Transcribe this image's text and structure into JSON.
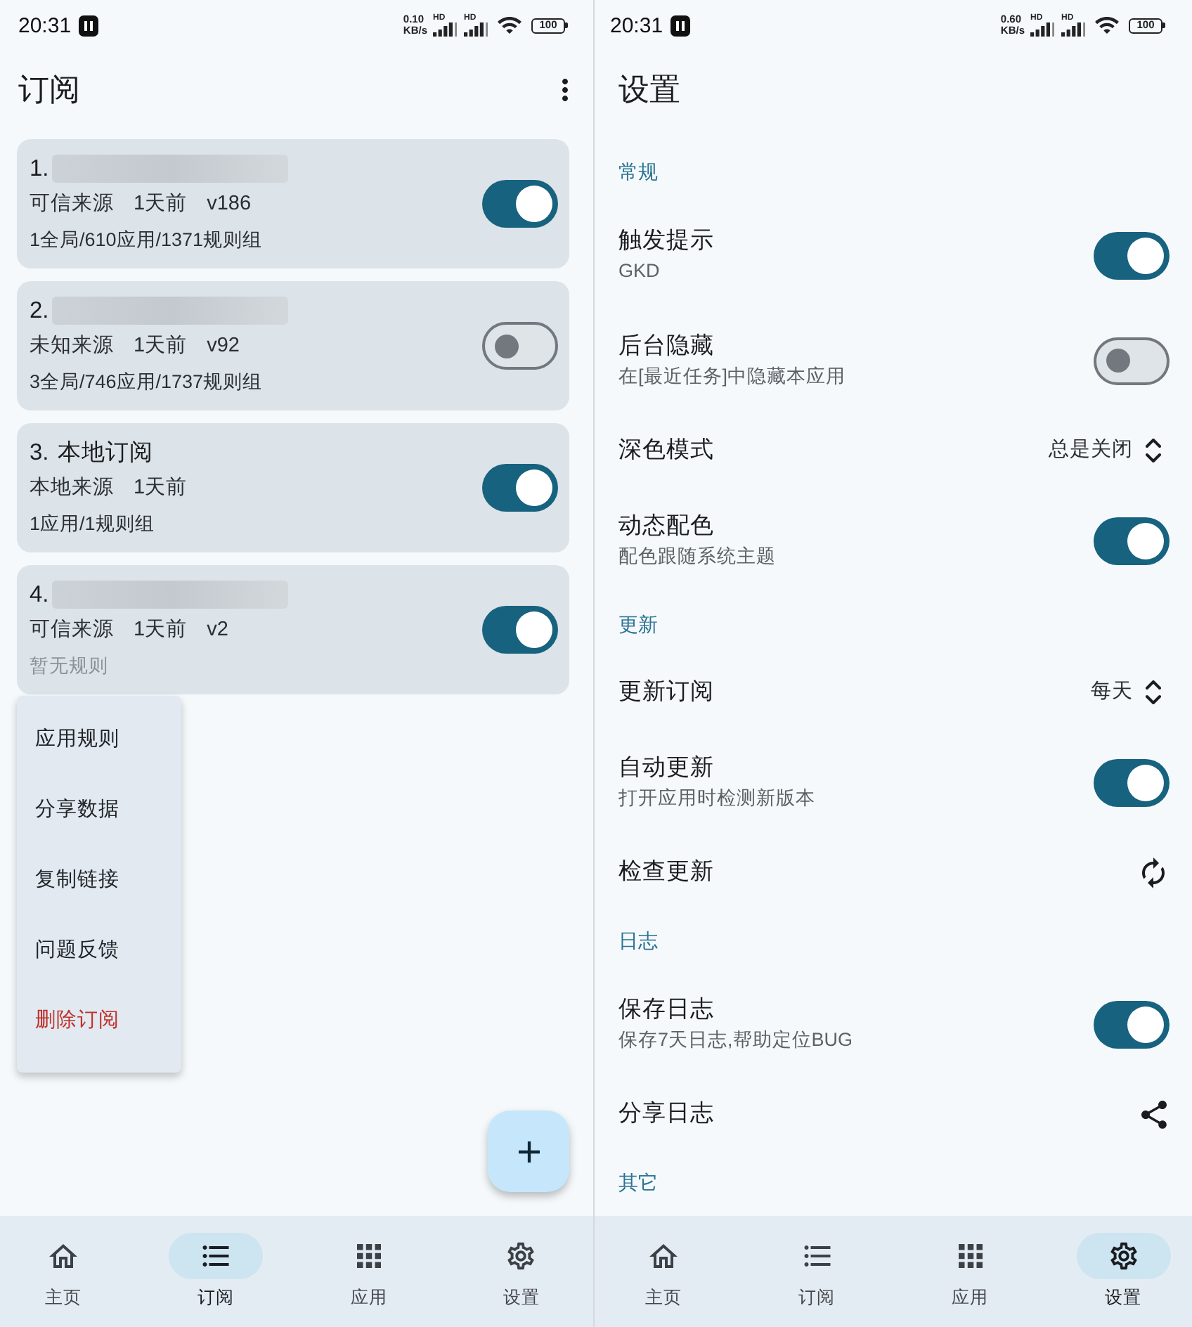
{
  "subscriptions_page": {
    "status_bar": {
      "time": "20:31",
      "net_speed": "0.10",
      "net_unit": "KB/s",
      "networks": [
        "HD",
        "HD"
      ],
      "battery": "100"
    },
    "title": "订阅",
    "cards": [
      {
        "number": "1.",
        "name_hidden": true,
        "source": "可信来源",
        "updated": "1天前",
        "version": "v186",
        "stats": "1全局/610应用/1371规则组",
        "stats_empty": false,
        "enabled": true
      },
      {
        "number": "2.",
        "name_hidden": true,
        "source": "未知来源",
        "updated": "1天前",
        "version": "v92",
        "stats": "3全局/746应用/1737规则组",
        "stats_empty": false,
        "enabled": false
      },
      {
        "number": "3.",
        "name_hidden": false,
        "name": "本地订阅",
        "source": "本地来源",
        "updated": "1天前",
        "stats": "1应用/1规则组",
        "stats_empty": false,
        "enabled": true
      },
      {
        "number": "4.",
        "name_hidden": true,
        "source": "可信来源",
        "updated": "1天前",
        "version": "v2",
        "stats": "暂无规则",
        "stats_empty": true,
        "enabled": true
      }
    ],
    "context_menu": [
      {
        "label": "应用规则",
        "danger": false
      },
      {
        "label": "分享数据",
        "danger": false
      },
      {
        "label": "复制链接",
        "danger": false
      },
      {
        "label": "问题反馈",
        "danger": false
      },
      {
        "label": "删除订阅",
        "danger": true
      }
    ],
    "bottom_nav": [
      {
        "kind": "home",
        "label": "主页",
        "selected": false
      },
      {
        "kind": "list",
        "label": "订阅",
        "selected": true
      },
      {
        "kind": "apps",
        "label": "应用",
        "selected": false
      },
      {
        "kind": "settings",
        "label": "设置",
        "selected": false
      }
    ]
  },
  "settings_page": {
    "status_bar": {
      "time": "20:31",
      "net_speed": "0.60",
      "net_unit": "KB/s",
      "networks": [
        "HD",
        "HD"
      ],
      "battery": "100"
    },
    "title": "设置",
    "sections": [
      {
        "header": "常规",
        "items": [
          {
            "kind": "switch",
            "title": "触发提示",
            "subtitle": "GKD",
            "on": true
          },
          {
            "kind": "switch",
            "title": "后台隐藏",
            "subtitle": "在[最近任务]中隐藏本应用",
            "on": false
          },
          {
            "kind": "select",
            "title": "深色模式",
            "value": "总是关闭"
          },
          {
            "kind": "switch",
            "title": "动态配色",
            "subtitle": "配色跟随系统主题",
            "on": true
          }
        ]
      },
      {
        "header": "更新",
        "items": [
          {
            "kind": "select",
            "title": "更新订阅",
            "value": "每天"
          },
          {
            "kind": "switch",
            "title": "自动更新",
            "subtitle": "打开应用时检测新版本",
            "on": true
          },
          {
            "kind": "refresh",
            "title": "检查更新"
          }
        ]
      },
      {
        "header": "日志",
        "items": [
          {
            "kind": "switch",
            "title": "保存日志",
            "subtitle": "保存7天日志,帮助定位BUG",
            "on": true
          },
          {
            "kind": "share",
            "title": "分享日志"
          }
        ]
      },
      {
        "header": "其它"
      }
    ],
    "bottom_nav": [
      {
        "kind": "home",
        "label": "主页",
        "selected": false
      },
      {
        "kind": "list",
        "label": "订阅",
        "selected": false
      },
      {
        "kind": "apps",
        "label": "应用",
        "selected": false
      },
      {
        "kind": "settings",
        "label": "设置",
        "selected": true
      }
    ]
  }
}
